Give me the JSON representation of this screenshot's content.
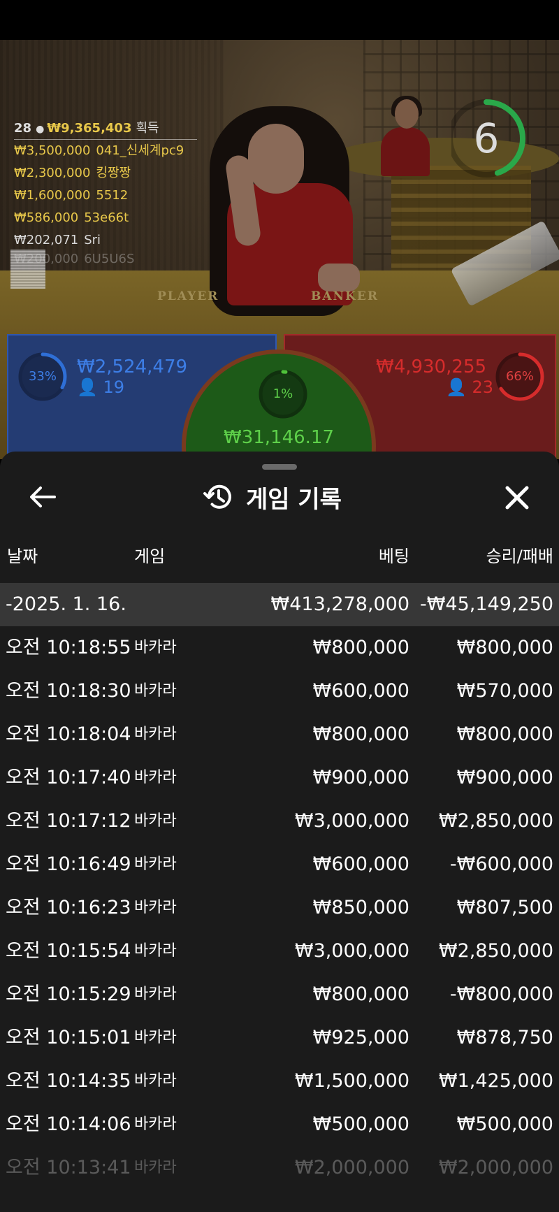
{
  "winners": {
    "count": "28",
    "total": "₩9,365,403",
    "label": "획득",
    "list": [
      {
        "amount": "₩3,500,000",
        "name": "041_신세계pc9"
      },
      {
        "amount": "₩2,300,000",
        "name": "킹짱짱"
      },
      {
        "amount": "₩1,600,000",
        "name": "5512"
      },
      {
        "amount": "₩586,000",
        "name": "53e66t"
      },
      {
        "amount": "₩202,071",
        "name": "Sri"
      },
      {
        "amount": "₩200,000",
        "name": "6U5U6S"
      }
    ]
  },
  "timer": {
    "value": "6",
    "fraction": 0.45
  },
  "table": {
    "player_label": "PLAYER",
    "banker_label": "BANKER"
  },
  "bets": {
    "player": {
      "pct": "33%",
      "pct_value": 0.33,
      "amount": "₩2,524,479",
      "players": "19",
      "color": "#2f6fd6"
    },
    "banker": {
      "pct": "66%",
      "pct_value": 0.66,
      "amount": "₩4,930,255",
      "players": "23",
      "color": "#d62c2c"
    },
    "tie": {
      "pct": "1%",
      "pct_value": 0.01,
      "amount": "₩31,146.17",
      "color": "#4fc13a"
    }
  },
  "history": {
    "title": "게임 기록",
    "columns": {
      "date": "날짜",
      "game": "게임",
      "bet": "베팅",
      "result": "승리/패배"
    },
    "group": {
      "date": "-2025. 1. 16.",
      "bet": "₩413,278,000",
      "result": "-₩45,149,250"
    },
    "rows": [
      {
        "time": "오전 10:18:55",
        "game": "바카라",
        "bet": "₩800,000",
        "result": "₩800,000"
      },
      {
        "time": "오전 10:18:30",
        "game": "바카라",
        "bet": "₩600,000",
        "result": "₩570,000"
      },
      {
        "time": "오전 10:18:04",
        "game": "바카라",
        "bet": "₩800,000",
        "result": "₩800,000"
      },
      {
        "time": "오전 10:17:40",
        "game": "바카라",
        "bet": "₩900,000",
        "result": "₩900,000"
      },
      {
        "time": "오전 10:17:12",
        "game": "바카라",
        "bet": "₩3,000,000",
        "result": "₩2,850,000"
      },
      {
        "time": "오전 10:16:49",
        "game": "바카라",
        "bet": "₩600,000",
        "result": "-₩600,000"
      },
      {
        "time": "오전 10:16:23",
        "game": "바카라",
        "bet": "₩850,000",
        "result": "₩807,500"
      },
      {
        "time": "오전 10:15:54",
        "game": "바카라",
        "bet": "₩3,000,000",
        "result": "₩2,850,000"
      },
      {
        "time": "오전 10:15:29",
        "game": "바카라",
        "bet": "₩800,000",
        "result": "-₩800,000"
      },
      {
        "time": "오전 10:15:01",
        "game": "바카라",
        "bet": "₩925,000",
        "result": "₩878,750"
      },
      {
        "time": "오전 10:14:35",
        "game": "바카라",
        "bet": "₩1,500,000",
        "result": "₩1,425,000"
      },
      {
        "time": "오전 10:14:06",
        "game": "바카라",
        "bet": "₩500,000",
        "result": "₩500,000"
      },
      {
        "time": "오전 10:13:41",
        "game": "바카라",
        "bet": "₩2,000,000",
        "result": "₩2,000,000"
      }
    ]
  },
  "icons": {
    "back": "arrow-left-icon",
    "history": "history-icon",
    "close": "close-icon",
    "user": "user-icon"
  }
}
